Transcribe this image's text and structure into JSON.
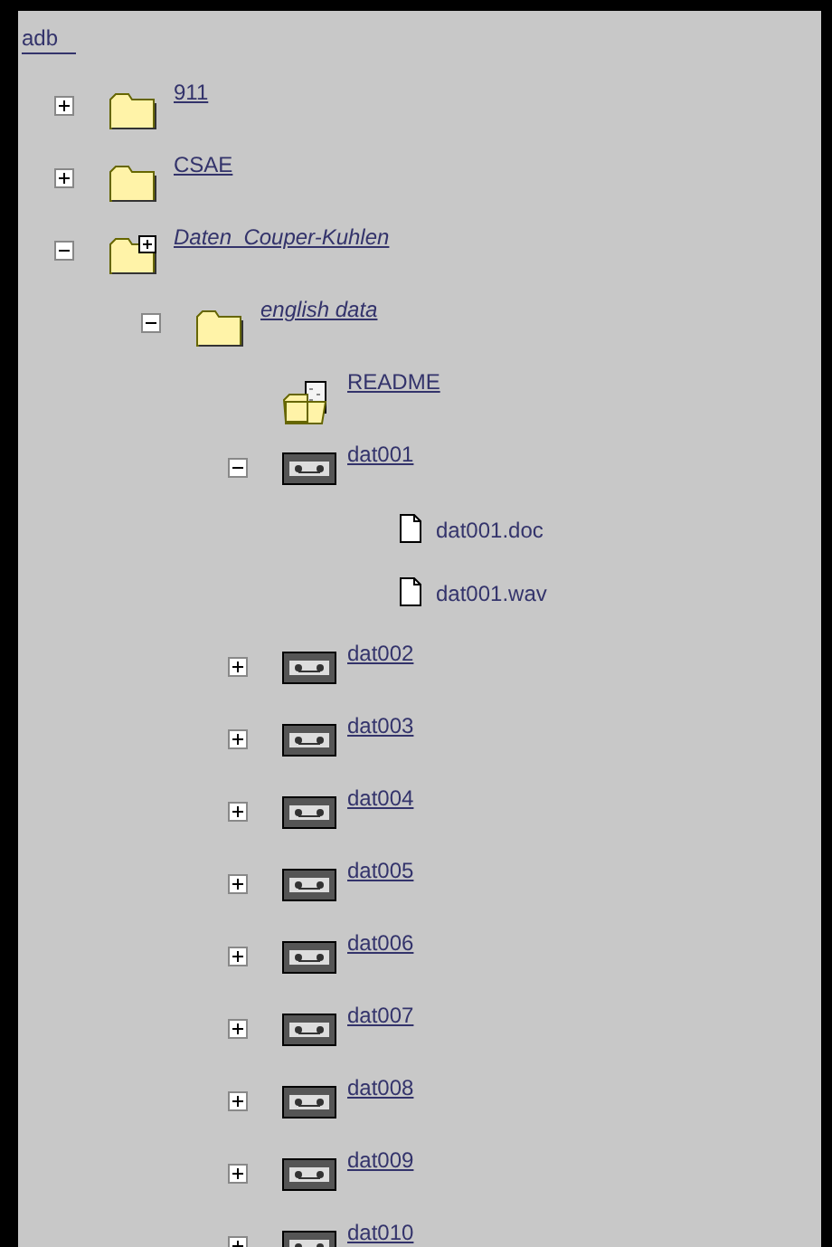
{
  "root": {
    "label": "adb"
  },
  "tree": [
    {
      "kind": "folder",
      "label": "911",
      "italic": false,
      "expanded": false
    },
    {
      "kind": "folder",
      "label": "CSAE",
      "italic": false,
      "expanded": false
    },
    {
      "kind": "folder-new",
      "label": "Daten  Couper-Kuhlen",
      "italic": true,
      "expanded": true,
      "children": [
        {
          "kind": "folder",
          "label": "english data",
          "italic": true,
          "expanded": true,
          "children": [
            {
              "kind": "readme",
              "label": "README",
              "italic": false
            },
            {
              "kind": "tape",
              "label": "dat001",
              "italic": false,
              "expanded": true,
              "children": [
                {
                  "kind": "file",
                  "label": "dat001.doc",
                  "italic": false
                },
                {
                  "kind": "file",
                  "label": "dat001.wav",
                  "italic": false
                }
              ]
            },
            {
              "kind": "tape",
              "label": "dat002",
              "italic": false,
              "expanded": false
            },
            {
              "kind": "tape",
              "label": "dat003",
              "italic": false,
              "expanded": false
            },
            {
              "kind": "tape",
              "label": "dat004",
              "italic": false,
              "expanded": false
            },
            {
              "kind": "tape",
              "label": "dat005",
              "italic": false,
              "expanded": false
            },
            {
              "kind": "tape",
              "label": "dat006",
              "italic": false,
              "expanded": false
            },
            {
              "kind": "tape",
              "label": "dat007",
              "italic": false,
              "expanded": false
            },
            {
              "kind": "tape",
              "label": "dat008",
              "italic": false,
              "expanded": false
            },
            {
              "kind": "tape",
              "label": "dat009",
              "italic": false,
              "expanded": false
            },
            {
              "kind": "tape",
              "label": "dat010",
              "italic": false,
              "expanded": false
            }
          ]
        }
      ]
    }
  ]
}
